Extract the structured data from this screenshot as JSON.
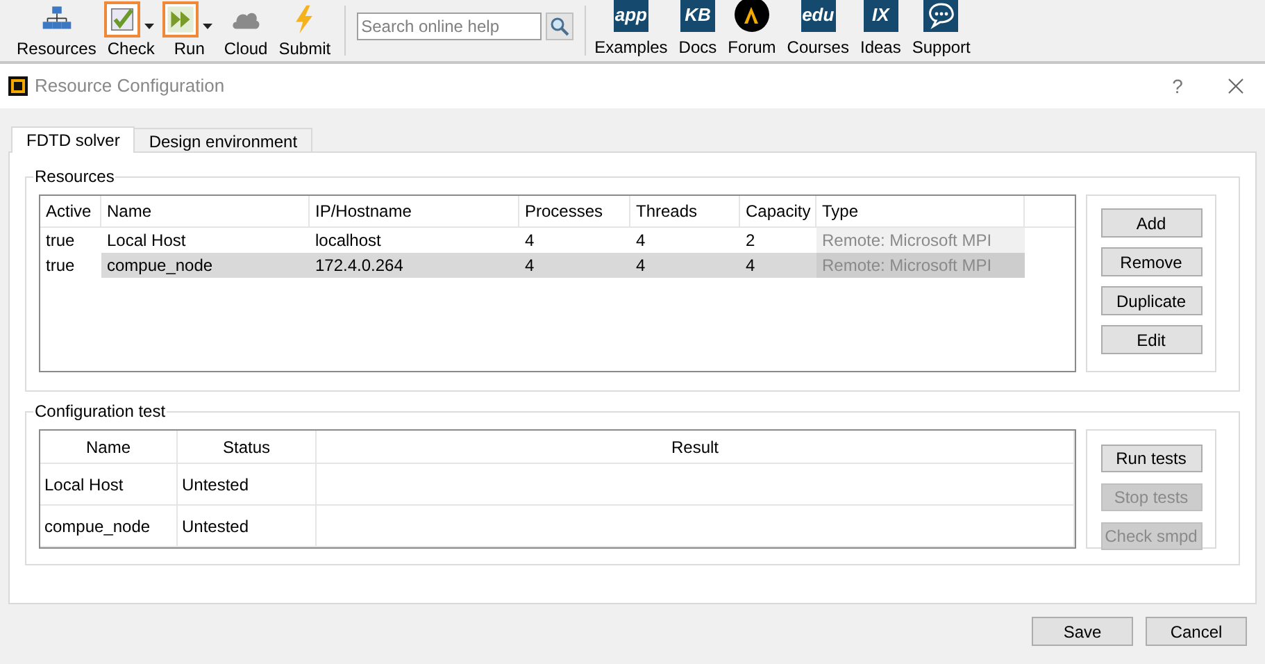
{
  "toolbar": {
    "items": [
      {
        "label": "Resources",
        "dropdown": false,
        "highlighted": false
      },
      {
        "label": "Check",
        "dropdown": true,
        "highlighted": true
      },
      {
        "label": "Run",
        "dropdown": true,
        "highlighted": true
      },
      {
        "label": "Cloud",
        "dropdown": false,
        "highlighted": false
      },
      {
        "label": "Submit",
        "dropdown": false,
        "highlighted": false
      }
    ],
    "search": {
      "placeholder": "Search online help"
    },
    "links": [
      {
        "label": "Examples",
        "glyph": "app"
      },
      {
        "label": "Docs",
        "glyph": "KB"
      },
      {
        "label": "Forum"
      },
      {
        "label": "Courses",
        "glyph": "edu"
      },
      {
        "label": "Ideas",
        "glyph": "IX"
      },
      {
        "label": "Support"
      }
    ]
  },
  "window": {
    "title": "Resource Configuration",
    "help": "?"
  },
  "tabs": [
    {
      "label": "FDTD solver",
      "selected": true
    },
    {
      "label": "Design environment",
      "selected": false
    }
  ],
  "resources": {
    "title": "Resources",
    "columns": [
      "Active",
      "Name",
      "IP/Hostname",
      "Processes",
      "Threads",
      "Capacity",
      "Type"
    ],
    "rows": [
      {
        "cells": [
          "true",
          "Local Host",
          "localhost",
          "4",
          "4",
          "2",
          "Remote: Microsoft MPI"
        ],
        "selected": false
      },
      {
        "cells": [
          "true",
          "compue_node",
          "172.4.0.264",
          "4",
          "4",
          "4",
          "Remote: Microsoft MPI"
        ],
        "selected": true
      }
    ],
    "buttons": [
      {
        "label": "Add",
        "disabled": false
      },
      {
        "label": "Remove",
        "disabled": false
      },
      {
        "label": "Duplicate",
        "disabled": false
      },
      {
        "label": "Edit",
        "disabled": false
      }
    ]
  },
  "configuration_test": {
    "title": "Configuration test",
    "columns": [
      "Name",
      "Status",
      "Result"
    ],
    "rows": [
      [
        "Local Host",
        "Untested",
        ""
      ],
      [
        "compue_node",
        "Untested",
        ""
      ]
    ],
    "buttons": [
      {
        "label": "Run tests",
        "disabled": false
      },
      {
        "label": "Stop tests",
        "disabled": true
      },
      {
        "label": "Check smpd",
        "disabled": true
      }
    ]
  },
  "footer": {
    "buttons": [
      "Save",
      "Cancel"
    ]
  }
}
